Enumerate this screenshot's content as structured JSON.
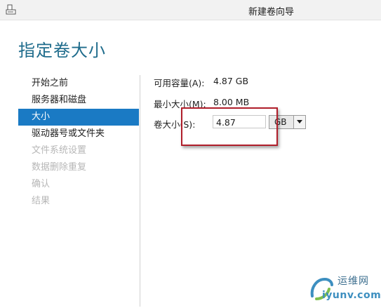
{
  "window": {
    "title": "新建卷向导"
  },
  "page": {
    "heading": "指定卷大小"
  },
  "nav": {
    "items": [
      {
        "label": "开始之前",
        "state": "normal"
      },
      {
        "label": "服务器和磁盘",
        "state": "normal"
      },
      {
        "label": "大小",
        "state": "active"
      },
      {
        "label": "驱动器号或文件夹",
        "state": "normal"
      },
      {
        "label": "文件系统设置",
        "state": "disabled"
      },
      {
        "label": "数据删除重复",
        "state": "disabled"
      },
      {
        "label": "确认",
        "state": "disabled"
      },
      {
        "label": "结果",
        "state": "disabled"
      }
    ]
  },
  "form": {
    "available_label": "可用容量(A):",
    "available_value": "4.87 GB",
    "min_label": "最小大小(M):",
    "min_value": "8.00 MB",
    "size_label": "卷大小(S):",
    "size_value": "4.87",
    "unit_value": "GB"
  },
  "watermark": {
    "cn": "运维网",
    "en": "iyunv.com"
  },
  "colors": {
    "heading": "#1f6c8c",
    "nav_active_bg": "#1a7ac4",
    "nav_disabled": "#b7b7b7",
    "highlight": "#b01e2a"
  }
}
